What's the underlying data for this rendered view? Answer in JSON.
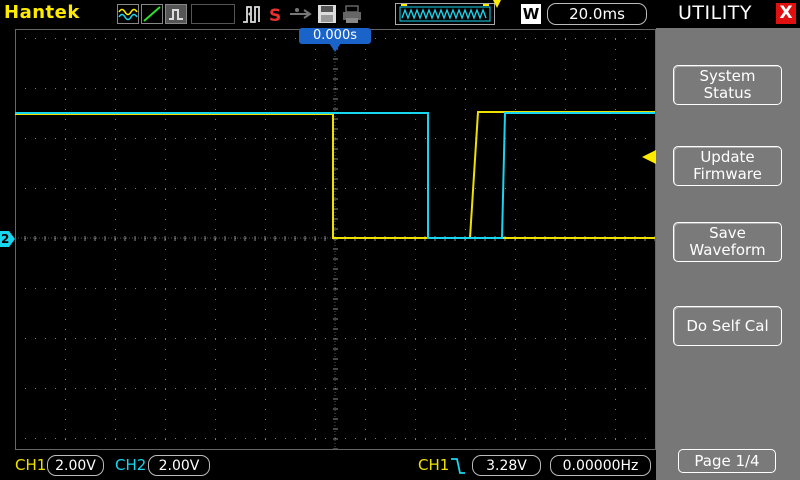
{
  "header": {
    "brand": "Hantek",
    "timebase_prefix": "W",
    "timebase": "20.0ms",
    "trigger_position": "0.000s",
    "icons": [
      "waveform-icon",
      "ramp-icon",
      "run-state-icon",
      "trigger-pulse-icon",
      "stop-icon",
      "usb-icon",
      "save-icon",
      "print-icon",
      "memory-waveform-icon"
    ]
  },
  "menu": {
    "title": "UTILITY",
    "close_label": "X",
    "items": [
      {
        "label": "System\nStatus"
      },
      {
        "label": "Update\nFirmware"
      },
      {
        "label": "Save\nWaveform"
      },
      {
        "label": "Do Self Cal"
      }
    ],
    "page": "Page 1/4"
  },
  "status": {
    "ch1_label": "CH1",
    "ch1_scale": "2.00V",
    "ch2_label": "CH2",
    "ch2_scale": "2.00V",
    "trigger_source": "CH1",
    "trigger_level": "3.28V",
    "frequency": "0.00000Hz"
  },
  "markers": {
    "ch2_marker": "2"
  },
  "colors": {
    "ch1": "#f0e000",
    "ch2": "#19d6f0",
    "brand": "#ffeb00",
    "close": "#e01010"
  }
}
